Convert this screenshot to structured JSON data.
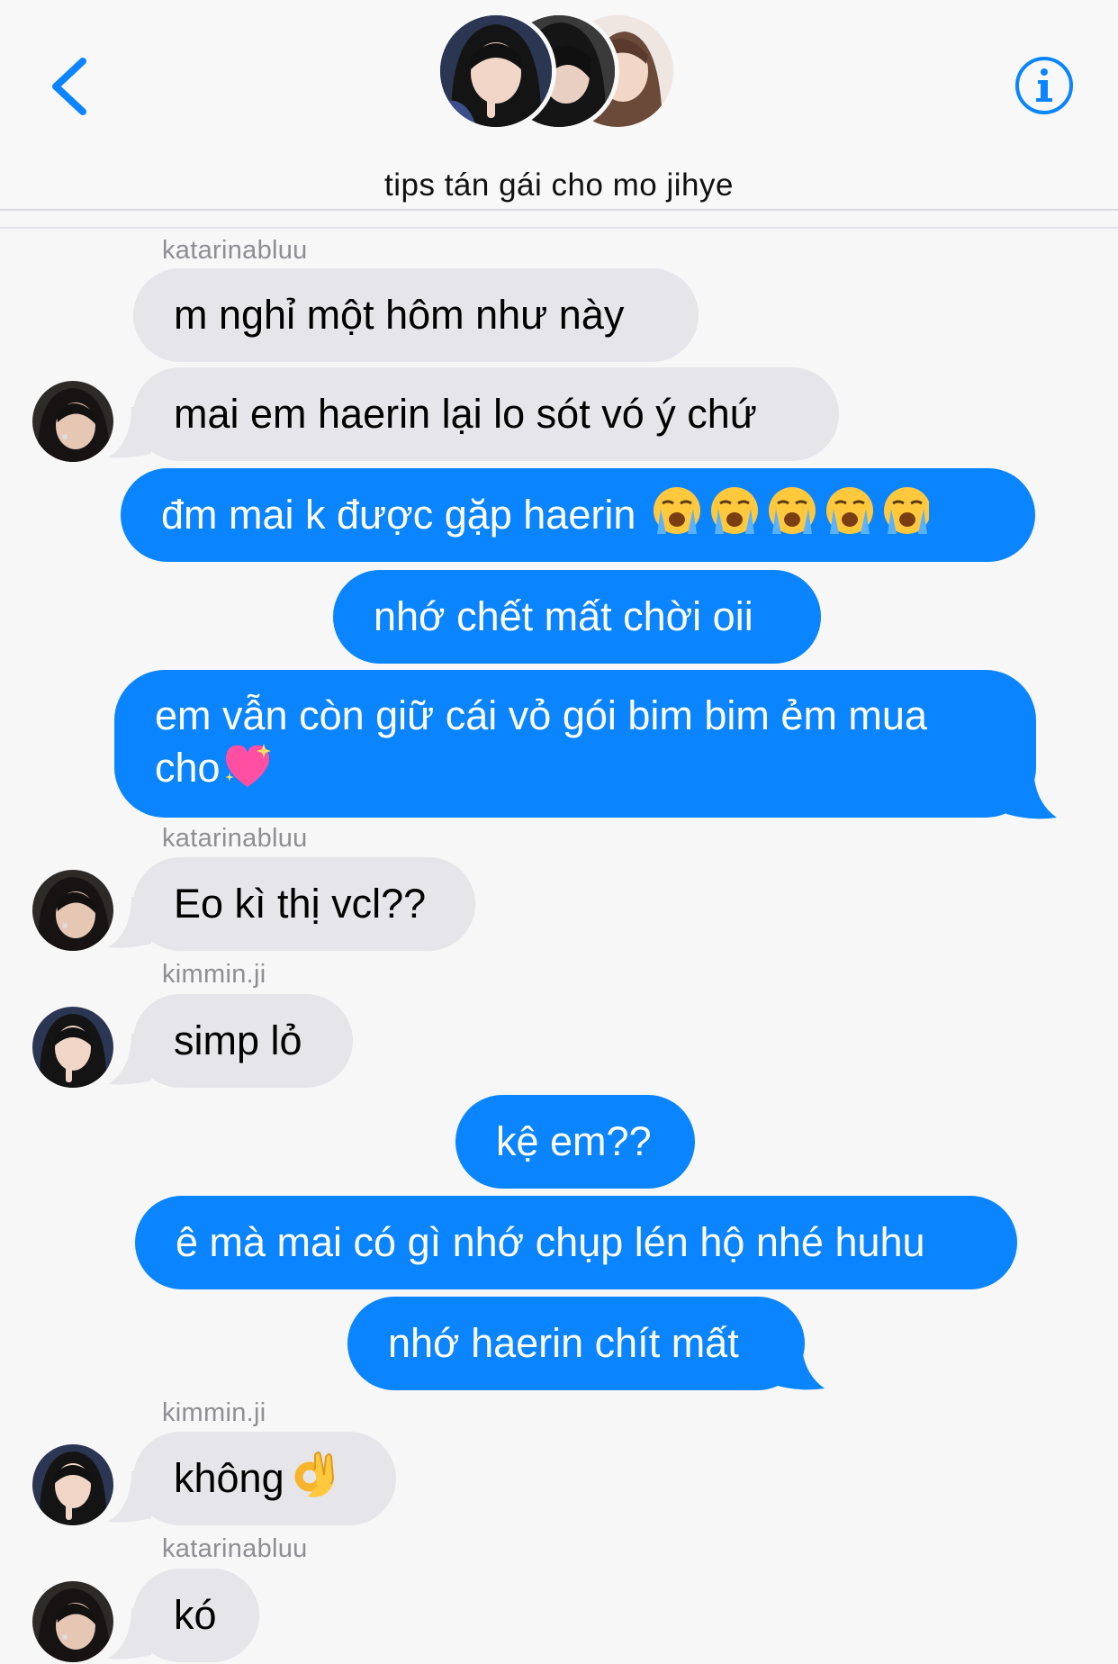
{
  "header": {
    "chat_title": "tips tán gái cho mo jihye",
    "back_label": "Back",
    "info_label": "i"
  },
  "accent_color": "#0a84ff",
  "incoming_color": "#e5e5ea",
  "messages": [
    {
      "sender": "katarinabluu",
      "text": "m nghỉ một hôm như này",
      "dir": "in"
    },
    {
      "text": "mai em haerin lại lo sót vó ý chứ",
      "dir": "in"
    },
    {
      "text": "đm mai k được gặp haerin",
      "dir": "out",
      "emoji": "loudly-crying-face x5"
    },
    {
      "text": "nhớ chết mất chời oii",
      "dir": "out"
    },
    {
      "text": "em vẫn còn giữ cái vỏ gói bim bim ẻm mua cho",
      "dir": "out",
      "emoji": "sparkling-heart"
    },
    {
      "sender": "katarinabluu",
      "text": "Eo kì thị vcl??",
      "dir": "in"
    },
    {
      "sender": "kimmin.ji",
      "text": "simp lỏ",
      "dir": "in"
    },
    {
      "text": "kệ em??",
      "dir": "out"
    },
    {
      "text": "ê mà mai có gì nhớ chụp lén hộ nhé huhu",
      "dir": "out"
    },
    {
      "text": "nhớ haerin chít mất",
      "dir": "out"
    },
    {
      "sender": "kimmin.ji",
      "text": "không",
      "dir": "in",
      "emoji": "ok-hand"
    },
    {
      "sender": "katarinabluu",
      "text": "kó",
      "dir": "in"
    }
  ]
}
